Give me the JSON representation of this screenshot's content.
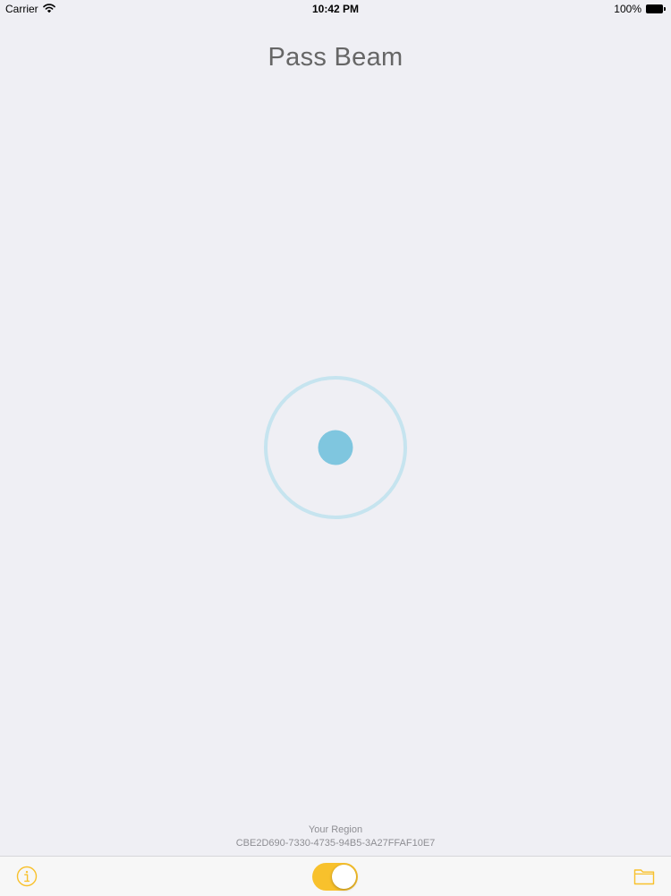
{
  "status_bar": {
    "carrier": "Carrier",
    "time": "10:42 PM",
    "battery_percent": "100%"
  },
  "title": "Pass Beam",
  "region": {
    "label": "Your Region",
    "uuid": "CBE2D690-7330-4735-94B5-3A27FFAF10E7"
  },
  "toolbar": {
    "toggle_on": true
  },
  "colors": {
    "accent": "#f8c12c",
    "beacon_dot": "#7fc6df",
    "beacon_ring": "#c6e4ef",
    "background": "#efeff4"
  },
  "icons": {
    "info": "info-icon",
    "folder": "folder-icon",
    "wifi": "wifi-icon",
    "battery": "battery-icon"
  }
}
